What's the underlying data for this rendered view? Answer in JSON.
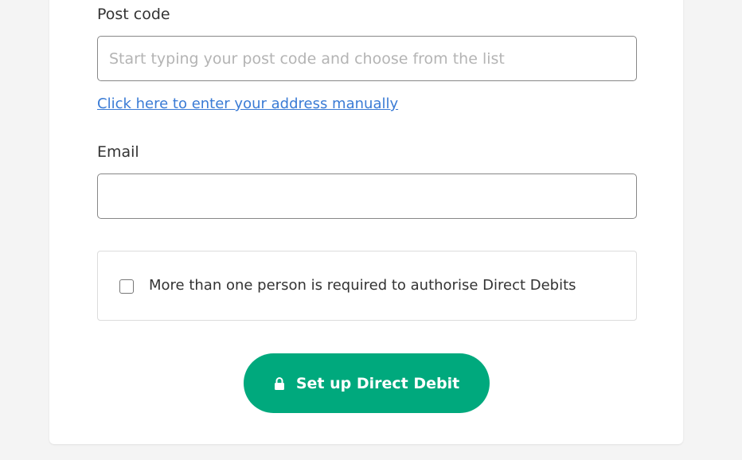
{
  "form": {
    "postcode_label": "Post code",
    "postcode_placeholder": "Start typing your post code and choose from the list",
    "postcode_value": "",
    "manual_address_link": "Click here to enter your address manually",
    "email_label": "Email",
    "email_value": "",
    "multi_signatory_label": "More than one person is required to authorise Direct Debits",
    "multi_signatory_checked": false,
    "submit_label": "Set up Direct Debit",
    "submit_icon": "lock-icon"
  },
  "colors": {
    "accent": "#00a97d",
    "link": "#3a7bd5",
    "background": "#f4f4f4"
  }
}
